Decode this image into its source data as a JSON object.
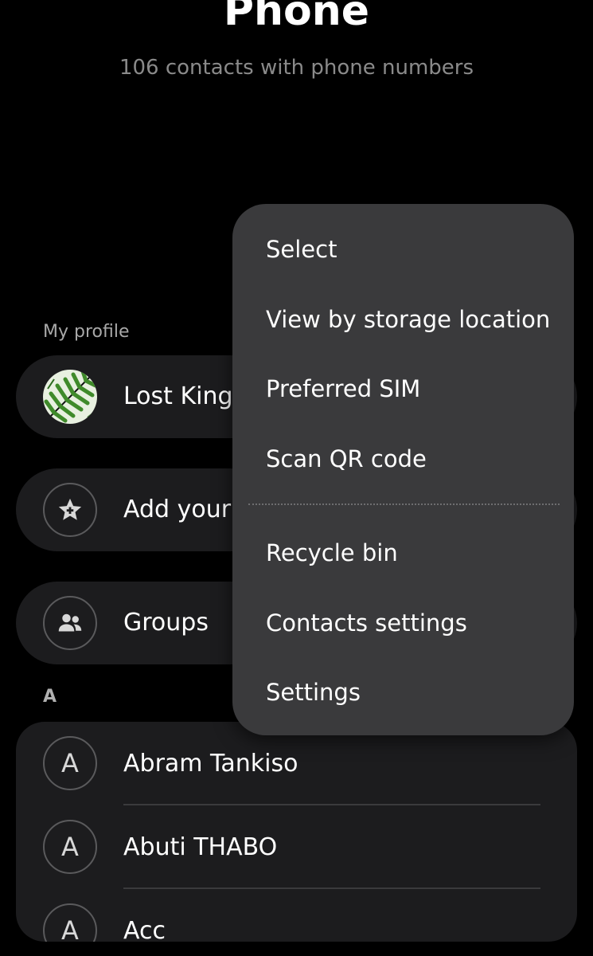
{
  "header": {
    "title": "Phone",
    "subtitle": "106 contacts with phone numbers"
  },
  "profile_section": {
    "label": "My profile",
    "profile_name": "Lost Kings",
    "add_label": "Add your favourites",
    "groups_label": "Groups"
  },
  "index_letter": "A",
  "contacts": [
    {
      "initial": "A",
      "name": "Abram Tankiso"
    },
    {
      "initial": "A",
      "name": "Abuti THABO"
    },
    {
      "initial": "A",
      "name": "Acc"
    }
  ],
  "menu": {
    "items": [
      {
        "label": "Select"
      },
      {
        "label": "View by storage location"
      },
      {
        "label": "Preferred SIM"
      },
      {
        "label": "Scan QR code"
      },
      {
        "label": "Recycle bin"
      },
      {
        "label": "Contacts settings"
      },
      {
        "label": "Settings"
      }
    ]
  },
  "icons": {
    "favourite": "star-plus-icon",
    "groups": "group-people-icon",
    "avatar": "fern-leaf-avatar"
  },
  "colors": {
    "background": "#000000",
    "card": "#1c1c1e",
    "menu": "#3a3a3c",
    "text": "#ffffff",
    "muted": "#8a8a8a"
  }
}
